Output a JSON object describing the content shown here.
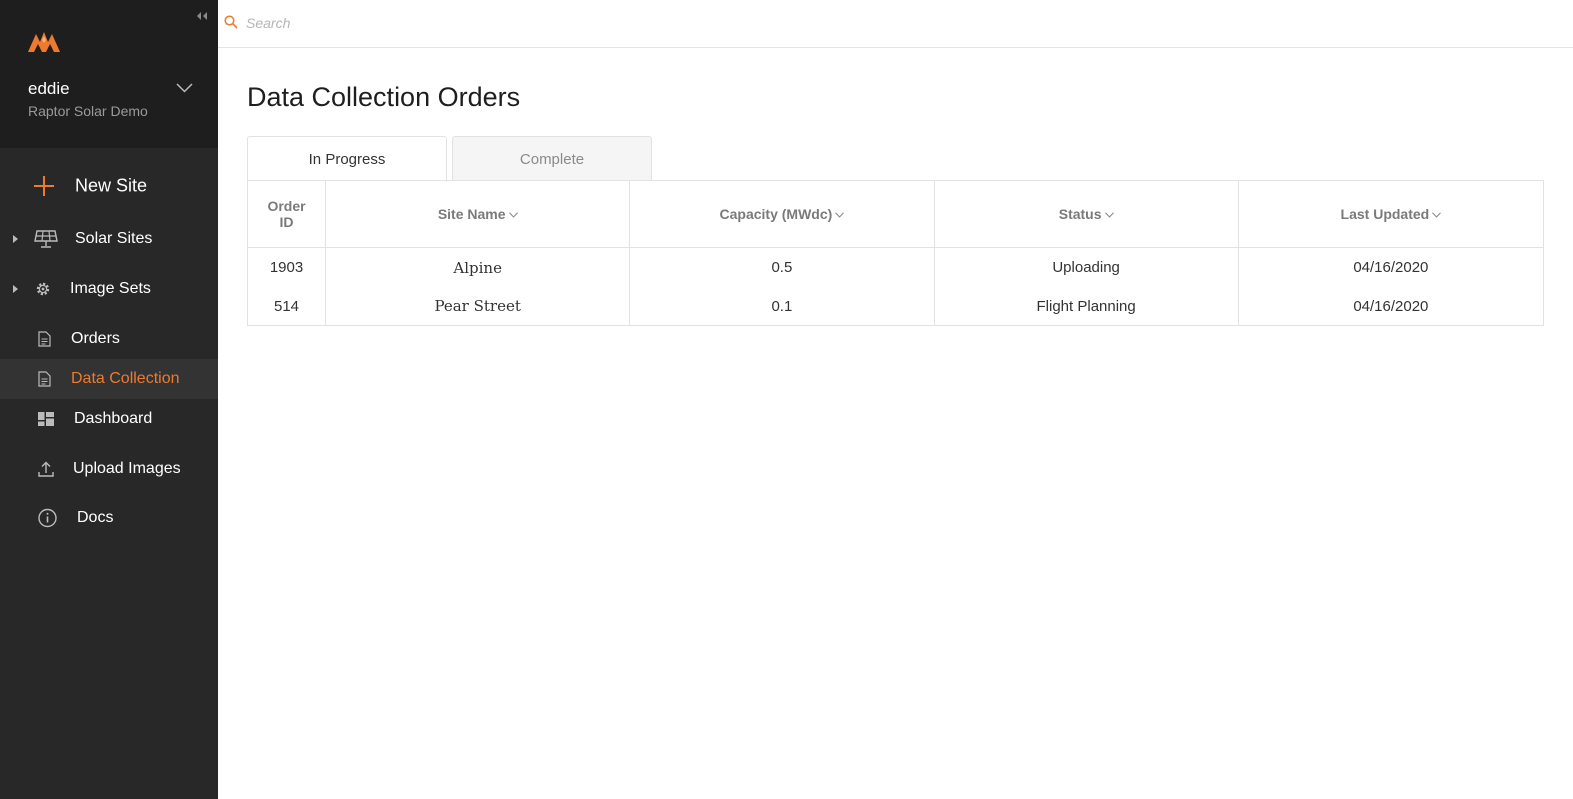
{
  "sidebar": {
    "user": {
      "name": "eddie",
      "org": "Raptor Solar Demo"
    },
    "items": [
      {
        "label": "New Site",
        "icon": "plus-icon"
      },
      {
        "label": "Solar Sites",
        "icon": "solar-panel-icon"
      },
      {
        "label": "Image Sets",
        "icon": "gear-icon"
      },
      {
        "label": "Orders",
        "icon": "document-icon"
      },
      {
        "label": "Data Collection",
        "icon": "document-icon"
      },
      {
        "label": "Dashboard",
        "icon": "dashboard-icon"
      },
      {
        "label": "Upload Images",
        "icon": "upload-icon"
      },
      {
        "label": "Docs",
        "icon": "info-icon"
      }
    ],
    "active_item": "Data Collection"
  },
  "search": {
    "placeholder": "Search"
  },
  "main": {
    "title": "Data Collection Orders",
    "tabs": [
      {
        "label": "In Progress",
        "active": true
      },
      {
        "label": "Complete",
        "active": false
      }
    ],
    "table": {
      "columns": [
        "Order",
        "ID",
        "Site Name",
        "Capacity (MWdc)",
        "Status",
        "Last Updated"
      ],
      "rows": [
        {
          "order_id": "1903",
          "site_name": "Alpine",
          "capacity": "0.5",
          "status": "Uploading",
          "last_updated": "04/16/2020"
        },
        {
          "order_id": "514",
          "site_name": "Pear Street",
          "capacity": "0.1",
          "status": "Flight Planning",
          "last_updated": "04/16/2020"
        }
      ]
    }
  },
  "colors": {
    "accent": "#ee7a2e",
    "sidebar_bg": "#282828",
    "sidebar_header_bg": "#1e1e1e",
    "active_item_bg": "#333333"
  }
}
